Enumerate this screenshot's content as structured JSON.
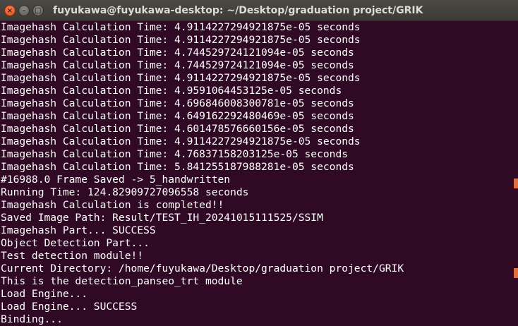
{
  "window": {
    "title": "fuyukawa@fuyukawa-desktop: ~/Desktop/graduation project/GRIK",
    "close_glyph": "×",
    "minimize_glyph": "–",
    "maximize_glyph": "□"
  },
  "terminal": {
    "lines": [
      "Imagehash Calculation Time: 4.9114227294921875e-05 seconds",
      "Imagehash Calculation Time: 4.9114227294921875e-05 seconds",
      "Imagehash Calculation Time: 4.744529724121094e-05 seconds",
      "Imagehash Calculation Time: 4.744529724121094e-05 seconds",
      "Imagehash Calculation Time: 4.9114227294921875e-05 seconds",
      "Imagehash Calculation Time: 4.9591064453125e-05 seconds",
      "Imagehash Calculation Time: 4.696846008300781e-05 seconds",
      "Imagehash Calculation Time: 4.649162292480469e-05 seconds",
      "Imagehash Calculation Time: 4.601478576660156e-05 seconds",
      "Imagehash Calculation Time: 4.9114227294921875e-05 seconds",
      "Imagehash Calculation Time: 4.76837158203125e-05 seconds",
      "Imagehash Calculation Time: 5.841255187988281e-05 seconds",
      "#16988.0 Frame Saved -> 5_handwritten",
      "Running Time: 124.82909727096558 seconds",
      "Imagehash Calculation is completed!!",
      "Saved Image Path: Result/TEST_IH_20241015111525/SSIM",
      "Imagehash Part... SUCCESS",
      "Object Detection Part...",
      "Test detection module!!",
      "Current Directory: /home/fuyukawa/Desktop/graduation project/GRIK",
      "This is the detection_panseo_trt module",
      "Load Engine...",
      "Load Engine... SUCCESS",
      "Binding..."
    ]
  },
  "colors": {
    "background": "#300a24",
    "text": "#ffffff",
    "accent": "#e16f40"
  }
}
